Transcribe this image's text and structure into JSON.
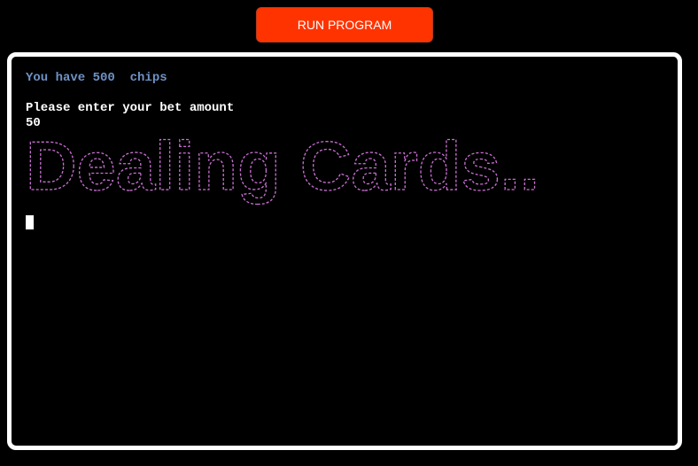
{
  "header": {
    "run_button_label": "RUN PROGRAM"
  },
  "terminal": {
    "chips_line": "You have 500  chips",
    "blank_line": "",
    "prompt_line": "Please enter your bet amount",
    "input_value": "50",
    "banner_text": "Dealing Cards..",
    "colors": {
      "background": "#000000",
      "frame": "#ffffff",
      "text": "#ffffff",
      "chips_text": "#6e92c6",
      "banner": "#c76fd0",
      "run_button": "#ff3300"
    }
  }
}
